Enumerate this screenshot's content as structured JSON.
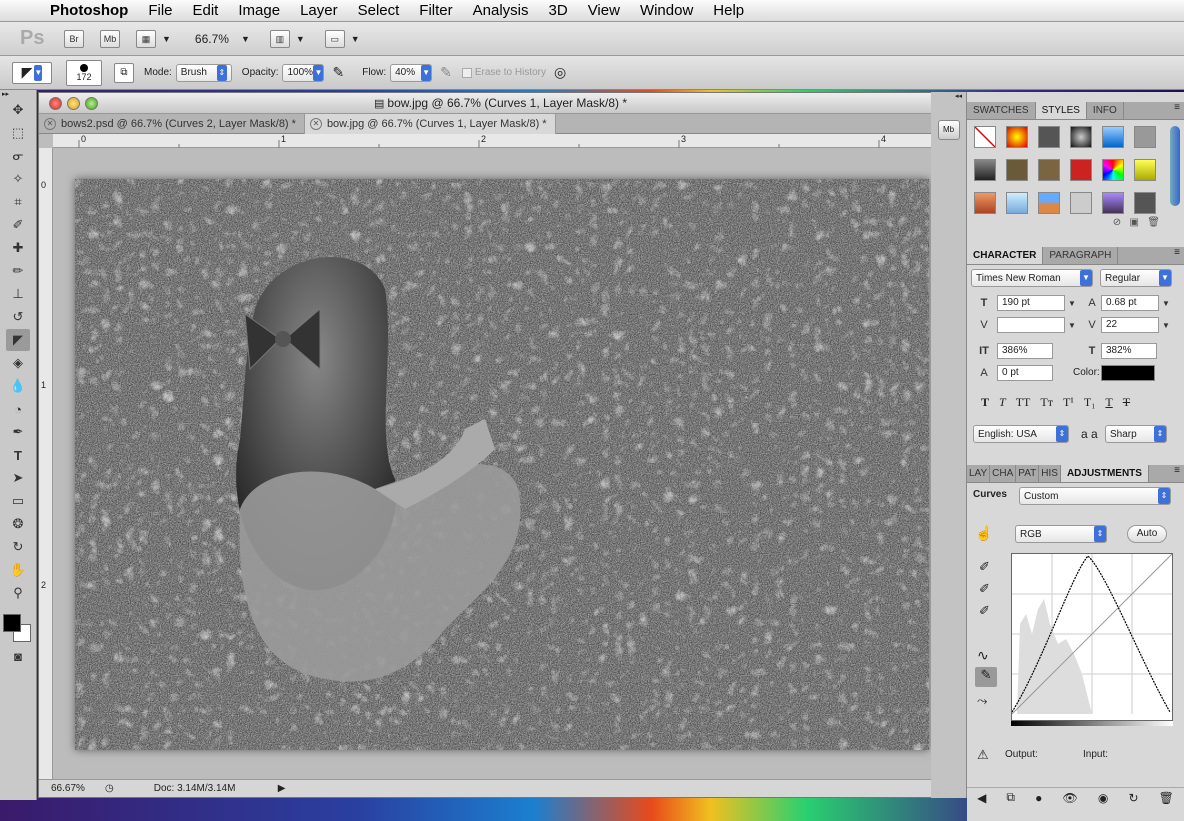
{
  "menubar": {
    "app_name": "Photoshop",
    "items": [
      "File",
      "Edit",
      "Image",
      "Layer",
      "Select",
      "Filter",
      "Analysis",
      "3D",
      "View",
      "Window",
      "Help"
    ]
  },
  "appbar": {
    "logo": "Ps",
    "bridge": "Br",
    "minibridge": "Mb",
    "zoom": "66.7%"
  },
  "options": {
    "brush_size": "172",
    "mode_label": "Mode:",
    "mode_value": "Brush",
    "opacity_label": "Opacity:",
    "opacity_value": "100%",
    "flow_label": "Flow:",
    "flow_value": "40%",
    "erase_history_label": "Erase to History"
  },
  "document": {
    "title": "bow.jpg @ 66.7% (Curves 1, Layer Mask/8) *",
    "tabs": [
      {
        "label": "bows2.psd @ 66.7% (Curves 2, Layer Mask/8) *"
      },
      {
        "label": "bow.jpg @ 66.7% (Curves 1, Layer Mask/8) *"
      }
    ],
    "ruler_h": [
      "0",
      "1",
      "2",
      "3",
      "4"
    ],
    "ruler_v": [
      "0",
      "1",
      "2"
    ],
    "status_zoom": "66.67%",
    "status_doc": "Doc: 3.14M/3.14M"
  },
  "swatches_panel": {
    "tabs": [
      "SWATCHES",
      "STYLES",
      "INFO"
    ]
  },
  "character_panel": {
    "tabs": [
      "CHARACTER",
      "PARAGRAPH"
    ],
    "font_family": "Times New Roman",
    "font_style": "Regular",
    "size": "190 pt",
    "leading": "0.68 pt",
    "kerning": "",
    "tracking": "22",
    "vscale": "386%",
    "hscale": "382%",
    "baseline": "0 pt",
    "color_label": "Color:",
    "text_color": "#000000",
    "language": "English: USA",
    "aa_label": "a a",
    "antialias": "Sharp"
  },
  "adjustments_panel": {
    "tabs": [
      "LAY",
      "CHA",
      "PAT",
      "HIS",
      "ADJUSTMENTS"
    ],
    "title": "Curves",
    "preset": "Custom",
    "channel": "RGB",
    "auto_label": "Auto",
    "output_label": "Output:",
    "input_label": "Input:"
  },
  "colors": {
    "accent_blue": "#3d70d9",
    "foreground": "#000000",
    "background": "#ffffff"
  }
}
